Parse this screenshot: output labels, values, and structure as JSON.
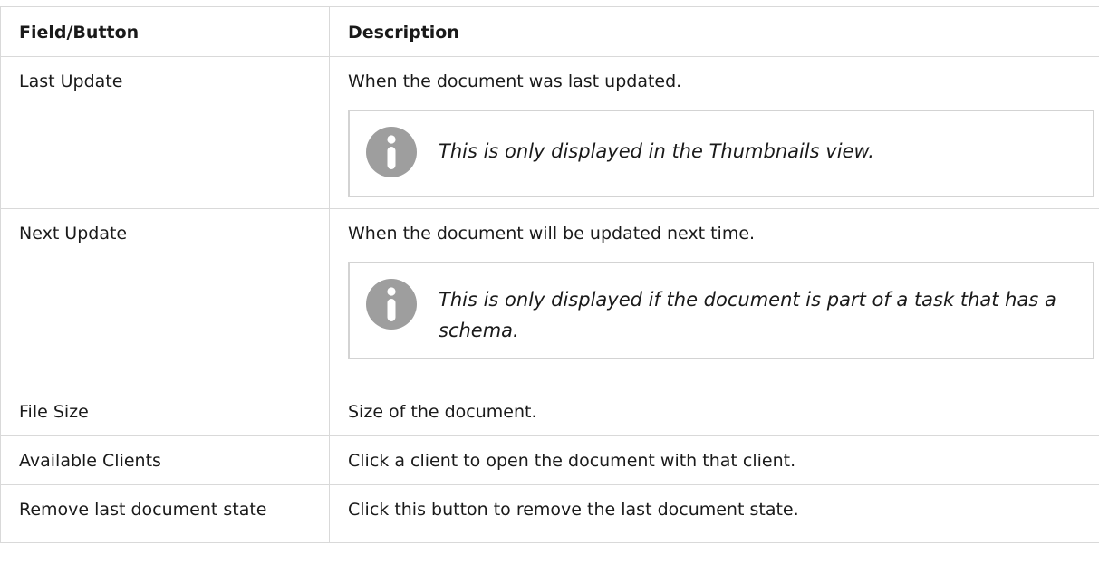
{
  "header": {
    "field_label": "Field/Button",
    "description_label": "Description"
  },
  "rows": [
    {
      "field": "Last Update",
      "description": "When the document was last updated.",
      "note": "This is only displayed in the Thumbnails view."
    },
    {
      "field": "Next Update",
      "description": "When the document will be updated next time.",
      "note": "This is only displayed if the document is part of a task that has a schema."
    },
    {
      "field": "File Size",
      "description": "Size of the document."
    },
    {
      "field": "Available Clients",
      "description": "Click a client to open the document with that client."
    },
    {
      "field": "Remove last document state",
      "description": "Click this button to remove the last document state."
    }
  ],
  "icons": {
    "note_icon": "info-icon"
  },
  "colors": {
    "icon_fill": "#9e9e9e",
    "border": "#d9d9d9"
  }
}
